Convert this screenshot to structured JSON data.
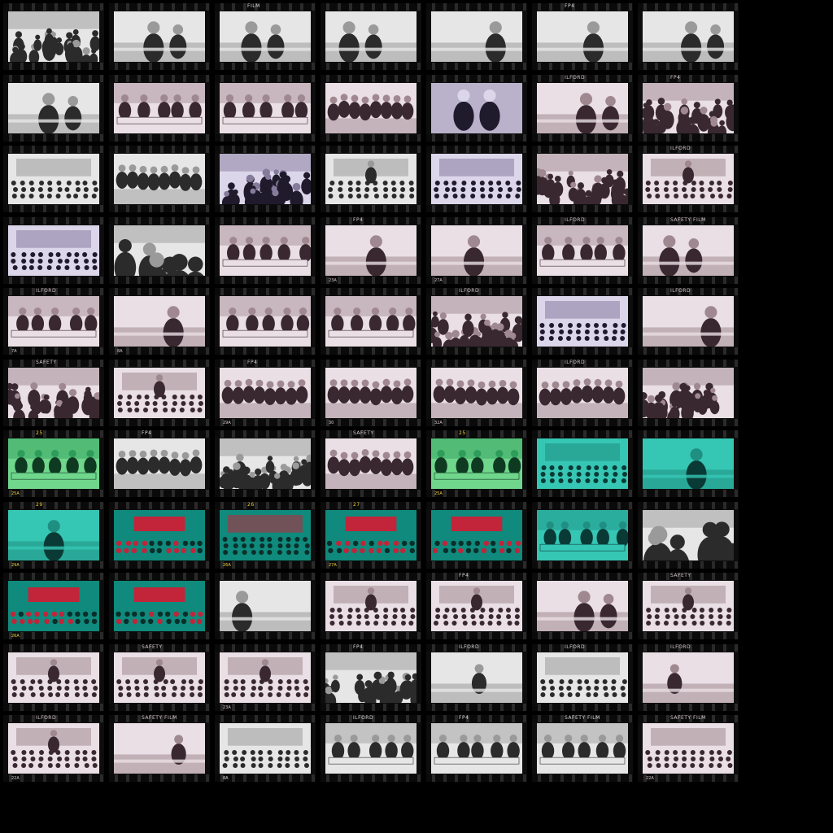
{
  "sheet": {
    "background": "#000000",
    "rows": 11,
    "cols": 7,
    "palettes": {
      "gray": {
        "paper": "#e6e6e6",
        "mid": "#9a9a9a",
        "dark": "#2b2b2b",
        "ink": "#dddddd"
      },
      "mauve": {
        "paper": "#e9dfe4",
        "mid": "#a08890",
        "dark": "#3a2830",
        "ink": "#d9c8cf"
      },
      "purple": {
        "paper": "#dcd6ea",
        "mid": "#857c9c",
        "dark": "#1f1a2c",
        "ink": "#cfc8e0"
      },
      "teal": {
        "paper": "#36c6b4",
        "mid": "#1f8f82",
        "dark": "#0a3a36",
        "ink": "#f2d23a"
      },
      "green": {
        "paper": "#6fd68c",
        "mid": "#2e9c5a",
        "dark": "#0f3a22",
        "ink": "#f2d23a"
      },
      "red": {
        "paper": "#0f8a7c",
        "mid": "#c2243a",
        "dark": "#0a2e2a",
        "ink": "#f2d23a"
      }
    }
  },
  "frames": [
    {
      "r": 0,
      "c": 0,
      "tone": "gray",
      "scene": "crowd",
      "label": "",
      "num": ""
    },
    {
      "r": 0,
      "c": 1,
      "tone": "gray",
      "scene": "portrait",
      "label": "",
      "num": ""
    },
    {
      "r": 0,
      "c": 2,
      "tone": "gray",
      "scene": "portrait",
      "label": "FILM",
      "num": ""
    },
    {
      "r": 0,
      "c": 3,
      "tone": "gray",
      "scene": "portrait",
      "label": "",
      "num": ""
    },
    {
      "r": 0,
      "c": 4,
      "tone": "gray",
      "scene": "portrait",
      "label": "",
      "num": ""
    },
    {
      "r": 0,
      "c": 5,
      "tone": "gray",
      "scene": "portrait",
      "label": "FP4",
      "num": ""
    },
    {
      "r": 0,
      "c": 6,
      "tone": "gray",
      "scene": "portrait",
      "label": "",
      "num": ""
    },
    {
      "r": 1,
      "c": 0,
      "tone": "gray",
      "scene": "portrait",
      "label": "",
      "num": ""
    },
    {
      "r": 1,
      "c": 1,
      "tone": "mauve",
      "scene": "meeting",
      "label": "",
      "num": ""
    },
    {
      "r": 1,
      "c": 2,
      "tone": "mauve",
      "scene": "meeting",
      "label": "",
      "num": ""
    },
    {
      "r": 1,
      "c": 3,
      "tone": "mauve",
      "scene": "group",
      "label": "",
      "num": ""
    },
    {
      "r": 1,
      "c": 4,
      "tone": "purple",
      "scene": "handshake",
      "label": "",
      "num": ""
    },
    {
      "r": 1,
      "c": 5,
      "tone": "mauve",
      "scene": "portrait",
      "label": "ILFORD",
      "num": ""
    },
    {
      "r": 1,
      "c": 6,
      "tone": "mauve",
      "scene": "crowd",
      "label": "FP4",
      "num": ""
    },
    {
      "r": 2,
      "c": 0,
      "tone": "gray",
      "scene": "hall",
      "label": "",
      "num": ""
    },
    {
      "r": 2,
      "c": 1,
      "tone": "gray",
      "scene": "group",
      "label": "",
      "num": ""
    },
    {
      "r": 2,
      "c": 2,
      "tone": "purple",
      "scene": "crowd",
      "label": "",
      "num": ""
    },
    {
      "r": 2,
      "c": 3,
      "tone": "gray",
      "scene": "stage",
      "label": "",
      "num": ""
    },
    {
      "r": 2,
      "c": 4,
      "tone": "purple",
      "scene": "hall",
      "label": "",
      "num": ""
    },
    {
      "r": 2,
      "c": 5,
      "tone": "mauve",
      "scene": "crowd",
      "label": "",
      "num": ""
    },
    {
      "r": 2,
      "c": 6,
      "tone": "mauve",
      "scene": "stage",
      "label": "ILFORD",
      "num": ""
    },
    {
      "r": 3,
      "c": 0,
      "tone": "purple",
      "scene": "hall",
      "label": "",
      "num": ""
    },
    {
      "r": 3,
      "c": 1,
      "tone": "gray",
      "scene": "closeup",
      "label": "",
      "num": ""
    },
    {
      "r": 3,
      "c": 2,
      "tone": "mauve",
      "scene": "meeting",
      "label": "",
      "num": ""
    },
    {
      "r": 3,
      "c": 3,
      "tone": "mauve",
      "scene": "portrait",
      "label": "FP4",
      "num": "23A"
    },
    {
      "r": 3,
      "c": 4,
      "tone": "mauve",
      "scene": "portrait",
      "label": "",
      "num": "27A"
    },
    {
      "r": 3,
      "c": 5,
      "tone": "mauve",
      "scene": "meeting",
      "label": "ILFORD",
      "num": ""
    },
    {
      "r": 3,
      "c": 6,
      "tone": "mauve",
      "scene": "portrait",
      "label": "SAFETY     FILM",
      "num": ""
    },
    {
      "r": 4,
      "c": 0,
      "tone": "mauve",
      "scene": "meeting",
      "label": "ILFORD",
      "num": "7A"
    },
    {
      "r": 4,
      "c": 1,
      "tone": "mauve",
      "scene": "portrait",
      "label": "",
      "num": "8A"
    },
    {
      "r": 4,
      "c": 2,
      "tone": "mauve",
      "scene": "meeting",
      "label": "",
      "num": ""
    },
    {
      "r": 4,
      "c": 3,
      "tone": "mauve",
      "scene": "meeting",
      "label": "",
      "num": ""
    },
    {
      "r": 4,
      "c": 4,
      "tone": "mauve",
      "scene": "crowd",
      "label": "ILFORD",
      "num": ""
    },
    {
      "r": 4,
      "c": 5,
      "tone": "purple",
      "scene": "hall",
      "label": "",
      "num": ""
    },
    {
      "r": 4,
      "c": 6,
      "tone": "mauve",
      "scene": "portrait",
      "label": "ILFORD",
      "num": ""
    },
    {
      "r": 5,
      "c": 0,
      "tone": "mauve",
      "scene": "crowd",
      "label": "SAFETY",
      "num": ""
    },
    {
      "r": 5,
      "c": 1,
      "tone": "mauve",
      "scene": "stage",
      "label": "",
      "num": ""
    },
    {
      "r": 5,
      "c": 2,
      "tone": "mauve",
      "scene": "group",
      "label": "FP4",
      "num": "29A"
    },
    {
      "r": 5,
      "c": 3,
      "tone": "mauve",
      "scene": "group",
      "label": "",
      "num": "30"
    },
    {
      "r": 5,
      "c": 4,
      "tone": "mauve",
      "scene": "group",
      "label": "",
      "num": "32A"
    },
    {
      "r": 5,
      "c": 5,
      "tone": "mauve",
      "scene": "group",
      "label": "ILFORD",
      "num": ""
    },
    {
      "r": 5,
      "c": 6,
      "tone": "mauve",
      "scene": "crowd",
      "label": "",
      "num": ""
    },
    {
      "r": 6,
      "c": 0,
      "tone": "green",
      "scene": "meeting",
      "label": "25",
      "num": "25A"
    },
    {
      "r": 6,
      "c": 1,
      "tone": "gray",
      "scene": "group",
      "label": "FP4",
      "num": ""
    },
    {
      "r": 6,
      "c": 2,
      "tone": "gray",
      "scene": "crowd",
      "label": "",
      "num": ""
    },
    {
      "r": 6,
      "c": 3,
      "tone": "mauve",
      "scene": "group",
      "label": "SAFETY",
      "num": ""
    },
    {
      "r": 6,
      "c": 4,
      "tone": "green",
      "scene": "meeting",
      "label": "25",
      "num": "25A"
    },
    {
      "r": 6,
      "c": 5,
      "tone": "teal",
      "scene": "hall",
      "label": "",
      "num": ""
    },
    {
      "r": 6,
      "c": 6,
      "tone": "teal",
      "scene": "portrait",
      "label": "",
      "num": ""
    },
    {
      "r": 7,
      "c": 0,
      "tone": "teal",
      "scene": "portrait",
      "label": "29",
      "num": "29A"
    },
    {
      "r": 7,
      "c": 1,
      "tone": "red",
      "scene": "banner",
      "label": "",
      "num": ""
    },
    {
      "r": 7,
      "c": 2,
      "tone": "red",
      "scene": "hall",
      "label": "26",
      "num": "26A"
    },
    {
      "r": 7,
      "c": 3,
      "tone": "red",
      "scene": "banner",
      "label": "27",
      "num": "27A"
    },
    {
      "r": 7,
      "c": 4,
      "tone": "red",
      "scene": "banner",
      "label": "",
      "num": ""
    },
    {
      "r": 7,
      "c": 5,
      "tone": "teal",
      "scene": "meeting",
      "label": "",
      "num": ""
    },
    {
      "r": 7,
      "c": 6,
      "tone": "gray",
      "scene": "closeup",
      "label": "",
      "num": ""
    },
    {
      "r": 8,
      "c": 0,
      "tone": "red",
      "scene": "banner",
      "label": "",
      "num": "26A"
    },
    {
      "r": 8,
      "c": 1,
      "tone": "red",
      "scene": "banner",
      "label": "",
      "num": ""
    },
    {
      "r": 8,
      "c": 2,
      "tone": "gray",
      "scene": "portrait",
      "label": "",
      "num": ""
    },
    {
      "r": 8,
      "c": 3,
      "tone": "mauve",
      "scene": "stage",
      "label": "",
      "num": ""
    },
    {
      "r": 8,
      "c": 4,
      "tone": "mauve",
      "scene": "stage",
      "label": "FP4",
      "num": ""
    },
    {
      "r": 8,
      "c": 5,
      "tone": "mauve",
      "scene": "portrait",
      "label": "",
      "num": ""
    },
    {
      "r": 8,
      "c": 6,
      "tone": "mauve",
      "scene": "stage",
      "label": "SAFETY",
      "num": ""
    },
    {
      "r": 9,
      "c": 0,
      "tone": "mauve",
      "scene": "stage",
      "label": "",
      "num": ""
    },
    {
      "r": 9,
      "c": 1,
      "tone": "mauve",
      "scene": "stage",
      "label": "SAFETY",
      "num": ""
    },
    {
      "r": 9,
      "c": 2,
      "tone": "mauve",
      "scene": "stage",
      "label": "",
      "num": "23A"
    },
    {
      "r": 9,
      "c": 3,
      "tone": "gray",
      "scene": "crowd",
      "label": "FP4",
      "num": ""
    },
    {
      "r": 9,
      "c": 4,
      "tone": "gray",
      "scene": "solo",
      "label": "ILFORD",
      "num": ""
    },
    {
      "r": 9,
      "c": 5,
      "tone": "gray",
      "scene": "hall",
      "label": "ILFORD",
      "num": ""
    },
    {
      "r": 9,
      "c": 6,
      "tone": "mauve",
      "scene": "solo",
      "label": "ILFORD",
      "num": ""
    },
    {
      "r": 10,
      "c": 0,
      "tone": "mauve",
      "scene": "stage",
      "label": "ILFORD",
      "num": "22A"
    },
    {
      "r": 10,
      "c": 1,
      "tone": "mauve",
      "scene": "solo",
      "label": "SAFETY     FILM",
      "num": ""
    },
    {
      "r": 10,
      "c": 2,
      "tone": "gray",
      "scene": "hall",
      "label": "",
      "num": "8A"
    },
    {
      "r": 10,
      "c": 3,
      "tone": "gray",
      "scene": "meeting",
      "label": "ILFORD",
      "num": ""
    },
    {
      "r": 10,
      "c": 4,
      "tone": "gray",
      "scene": "meeting",
      "label": "FP4",
      "num": ""
    },
    {
      "r": 10,
      "c": 5,
      "tone": "gray",
      "scene": "meeting",
      "label": "SAFETY     FILM",
      "num": ""
    },
    {
      "r": 10,
      "c": 6,
      "tone": "mauve",
      "scene": "hall",
      "label": "SAFETY     FILM",
      "num": "22A"
    }
  ]
}
